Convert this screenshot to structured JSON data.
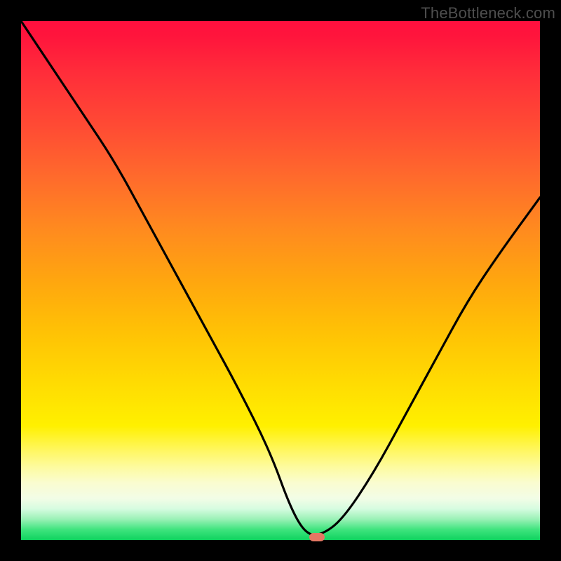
{
  "watermark": "TheBottleneck.com",
  "colors": {
    "frame": "#000000",
    "curve": "#000000",
    "marker": "#e47763",
    "gradient_stops": [
      "#ff0f3e",
      "#ff6a2c",
      "#ffdc02",
      "#fafcd0",
      "#0fd35f"
    ]
  },
  "chart_data": {
    "type": "line",
    "title": "",
    "xlabel": "",
    "ylabel": "",
    "xlim": [
      0,
      100
    ],
    "ylim": [
      0,
      100
    ],
    "grid": false,
    "legend": false,
    "series": [
      {
        "name": "bottleneck-curve",
        "x": [
          0,
          6,
          12,
          18,
          24,
          30,
          36,
          42,
          48,
          52,
          55,
          58,
          62,
          68,
          74,
          80,
          86,
          92,
          100
        ],
        "y": [
          100,
          91,
          82,
          73,
          62,
          51,
          40,
          29,
          17,
          6,
          1,
          1,
          4,
          13,
          24,
          35,
          46,
          55,
          66
        ]
      }
    ],
    "annotations": [
      {
        "name": "optimal-marker",
        "x": 57,
        "y": 0.5,
        "shape": "pill",
        "color": "#e47763"
      }
    ],
    "background": {
      "kind": "vertical-gradient",
      "meaning": "red=high bottleneck, green=optimal",
      "stops": [
        {
          "pos": 0.0,
          "color": "#ff0f3e"
        },
        {
          "pos": 0.5,
          "color": "#ffa60f"
        },
        {
          "pos": 0.8,
          "color": "#fff000"
        },
        {
          "pos": 0.92,
          "color": "#f2fde6"
        },
        {
          "pos": 1.0,
          "color": "#0fd35f"
        }
      ]
    }
  }
}
